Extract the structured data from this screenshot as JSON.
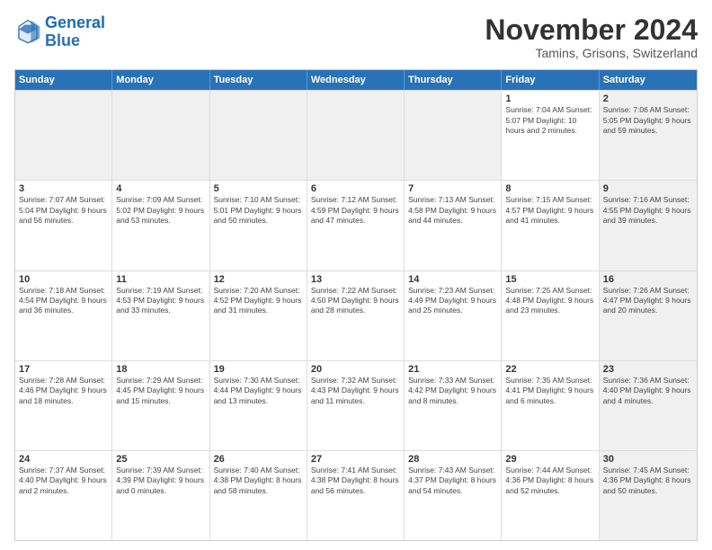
{
  "logo": {
    "line1": "General",
    "line2": "Blue"
  },
  "title": "November 2024",
  "subtitle": "Tamins, Grisons, Switzerland",
  "header_days": [
    "Sunday",
    "Monday",
    "Tuesday",
    "Wednesday",
    "Thursday",
    "Friday",
    "Saturday"
  ],
  "rows": [
    [
      {
        "day": "",
        "info": "",
        "shaded": true
      },
      {
        "day": "",
        "info": "",
        "shaded": true
      },
      {
        "day": "",
        "info": "",
        "shaded": true
      },
      {
        "day": "",
        "info": "",
        "shaded": true
      },
      {
        "day": "",
        "info": "",
        "shaded": true
      },
      {
        "day": "1",
        "info": "Sunrise: 7:04 AM\nSunset: 5:07 PM\nDaylight: 10 hours\nand 2 minutes.",
        "shaded": false
      },
      {
        "day": "2",
        "info": "Sunrise: 7:06 AM\nSunset: 5:05 PM\nDaylight: 9 hours\nand 59 minutes.",
        "shaded": true
      }
    ],
    [
      {
        "day": "3",
        "info": "Sunrise: 7:07 AM\nSunset: 5:04 PM\nDaylight: 9 hours\nand 56 minutes.",
        "shaded": false
      },
      {
        "day": "4",
        "info": "Sunrise: 7:09 AM\nSunset: 5:02 PM\nDaylight: 9 hours\nand 53 minutes.",
        "shaded": false
      },
      {
        "day": "5",
        "info": "Sunrise: 7:10 AM\nSunset: 5:01 PM\nDaylight: 9 hours\nand 50 minutes.",
        "shaded": false
      },
      {
        "day": "6",
        "info": "Sunrise: 7:12 AM\nSunset: 4:59 PM\nDaylight: 9 hours\nand 47 minutes.",
        "shaded": false
      },
      {
        "day": "7",
        "info": "Sunrise: 7:13 AM\nSunset: 4:58 PM\nDaylight: 9 hours\nand 44 minutes.",
        "shaded": false
      },
      {
        "day": "8",
        "info": "Sunrise: 7:15 AM\nSunset: 4:57 PM\nDaylight: 9 hours\nand 41 minutes.",
        "shaded": false
      },
      {
        "day": "9",
        "info": "Sunrise: 7:16 AM\nSunset: 4:55 PM\nDaylight: 9 hours\nand 39 minutes.",
        "shaded": true
      }
    ],
    [
      {
        "day": "10",
        "info": "Sunrise: 7:18 AM\nSunset: 4:54 PM\nDaylight: 9 hours\nand 36 minutes.",
        "shaded": false
      },
      {
        "day": "11",
        "info": "Sunrise: 7:19 AM\nSunset: 4:53 PM\nDaylight: 9 hours\nand 33 minutes.",
        "shaded": false
      },
      {
        "day": "12",
        "info": "Sunrise: 7:20 AM\nSunset: 4:52 PM\nDaylight: 9 hours\nand 31 minutes.",
        "shaded": false
      },
      {
        "day": "13",
        "info": "Sunrise: 7:22 AM\nSunset: 4:50 PM\nDaylight: 9 hours\nand 28 minutes.",
        "shaded": false
      },
      {
        "day": "14",
        "info": "Sunrise: 7:23 AM\nSunset: 4:49 PM\nDaylight: 9 hours\nand 25 minutes.",
        "shaded": false
      },
      {
        "day": "15",
        "info": "Sunrise: 7:25 AM\nSunset: 4:48 PM\nDaylight: 9 hours\nand 23 minutes.",
        "shaded": false
      },
      {
        "day": "16",
        "info": "Sunrise: 7:26 AM\nSunset: 4:47 PM\nDaylight: 9 hours\nand 20 minutes.",
        "shaded": true
      }
    ],
    [
      {
        "day": "17",
        "info": "Sunrise: 7:28 AM\nSunset: 4:46 PM\nDaylight: 9 hours\nand 18 minutes.",
        "shaded": false
      },
      {
        "day": "18",
        "info": "Sunrise: 7:29 AM\nSunset: 4:45 PM\nDaylight: 9 hours\nand 15 minutes.",
        "shaded": false
      },
      {
        "day": "19",
        "info": "Sunrise: 7:30 AM\nSunset: 4:44 PM\nDaylight: 9 hours\nand 13 minutes.",
        "shaded": false
      },
      {
        "day": "20",
        "info": "Sunrise: 7:32 AM\nSunset: 4:43 PM\nDaylight: 9 hours\nand 11 minutes.",
        "shaded": false
      },
      {
        "day": "21",
        "info": "Sunrise: 7:33 AM\nSunset: 4:42 PM\nDaylight: 9 hours\nand 8 minutes.",
        "shaded": false
      },
      {
        "day": "22",
        "info": "Sunrise: 7:35 AM\nSunset: 4:41 PM\nDaylight: 9 hours\nand 6 minutes.",
        "shaded": false
      },
      {
        "day": "23",
        "info": "Sunrise: 7:36 AM\nSunset: 4:40 PM\nDaylight: 9 hours\nand 4 minutes.",
        "shaded": true
      }
    ],
    [
      {
        "day": "24",
        "info": "Sunrise: 7:37 AM\nSunset: 4:40 PM\nDaylight: 9 hours\nand 2 minutes.",
        "shaded": false
      },
      {
        "day": "25",
        "info": "Sunrise: 7:39 AM\nSunset: 4:39 PM\nDaylight: 9 hours\nand 0 minutes.",
        "shaded": false
      },
      {
        "day": "26",
        "info": "Sunrise: 7:40 AM\nSunset: 4:38 PM\nDaylight: 8 hours\nand 58 minutes.",
        "shaded": false
      },
      {
        "day": "27",
        "info": "Sunrise: 7:41 AM\nSunset: 4:38 PM\nDaylight: 8 hours\nand 56 minutes.",
        "shaded": false
      },
      {
        "day": "28",
        "info": "Sunrise: 7:43 AM\nSunset: 4:37 PM\nDaylight: 8 hours\nand 54 minutes.",
        "shaded": false
      },
      {
        "day": "29",
        "info": "Sunrise: 7:44 AM\nSunset: 4:36 PM\nDaylight: 8 hours\nand 52 minutes.",
        "shaded": false
      },
      {
        "day": "30",
        "info": "Sunrise: 7:45 AM\nSunset: 4:36 PM\nDaylight: 8 hours\nand 50 minutes.",
        "shaded": true
      }
    ]
  ]
}
